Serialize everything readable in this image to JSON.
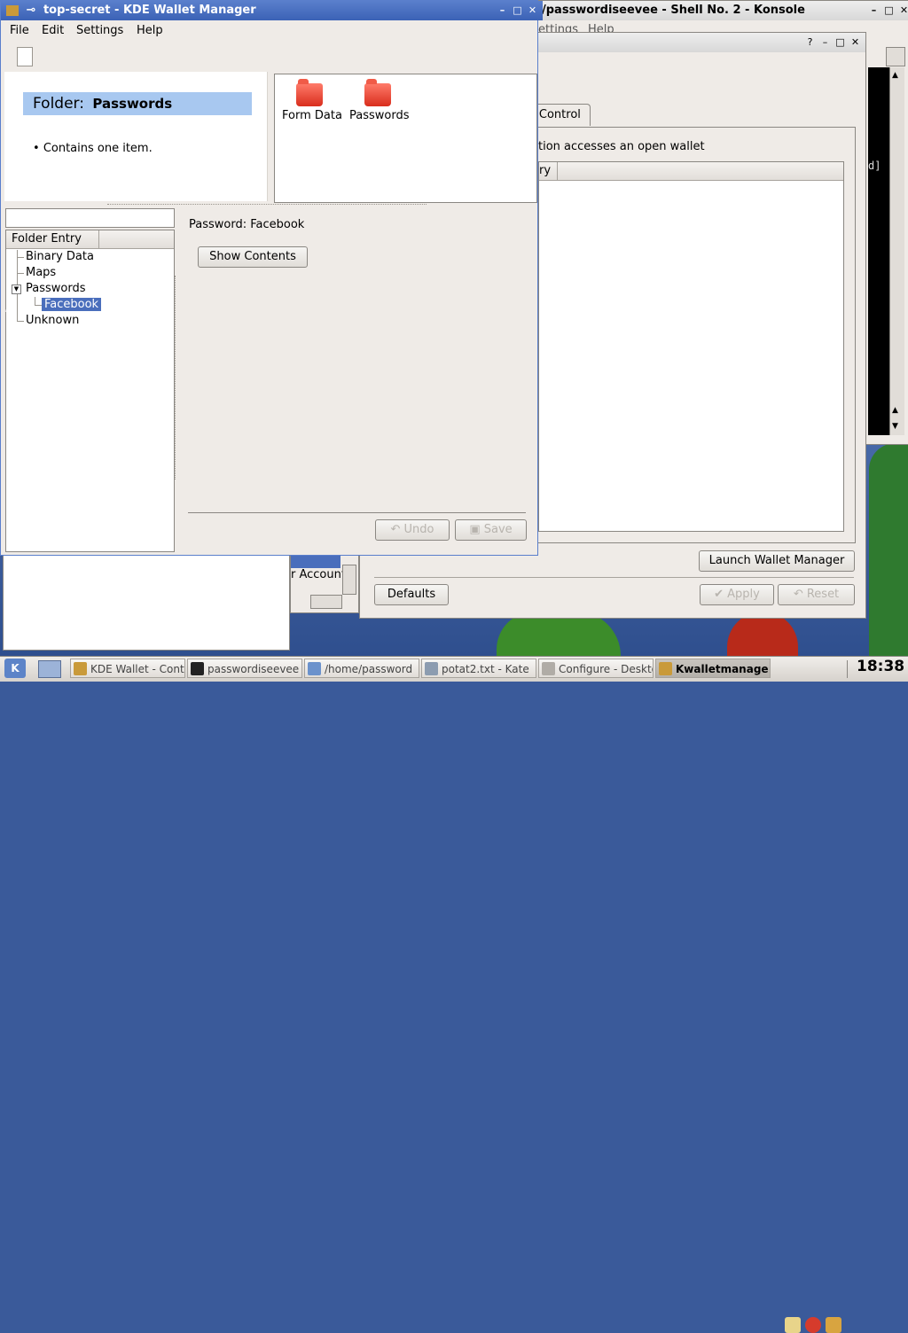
{
  "konsole": {
    "title": "/passwordiseevee - Shell No. 2 - Konsole",
    "menu": [
      "ettings",
      "Help"
    ]
  },
  "kcontrol": {
    "tab_label": "s Control",
    "desc": "tion accesses an open wallet",
    "col_header": "ry",
    "launch_button": "Launch Wallet Manager",
    "defaults_button": "Defaults",
    "apply_button": "Apply",
    "reset_button": "Reset",
    "partial_label": "r Account"
  },
  "wallet": {
    "title": "top-secret - KDE Wallet Manager",
    "menu": [
      "File",
      "Edit",
      "Settings",
      "Help"
    ],
    "folder_prefix": "Folder:",
    "folder_name": "Passwords",
    "folder_note": "Contains one item.",
    "folders": [
      "Form Data",
      "Passwords"
    ],
    "tree_header": [
      "Folder",
      "Entry"
    ],
    "tree": {
      "binary": "Binary Data",
      "maps": "Maps",
      "passwords": "Passwords",
      "facebook": "Facebook",
      "unknown": "Unknown"
    },
    "entry_title": "Password: Facebook",
    "show_contents": "Show Contents",
    "undo": "Undo",
    "save": "Save"
  },
  "taskbar": {
    "tasks": [
      "KDE Wallet - Contro",
      "passwordiseevee",
      "/home/password",
      "potat2.txt - Kate",
      "Configure - Deskto",
      "Kwalletmanage"
    ],
    "clock": "18:38"
  }
}
